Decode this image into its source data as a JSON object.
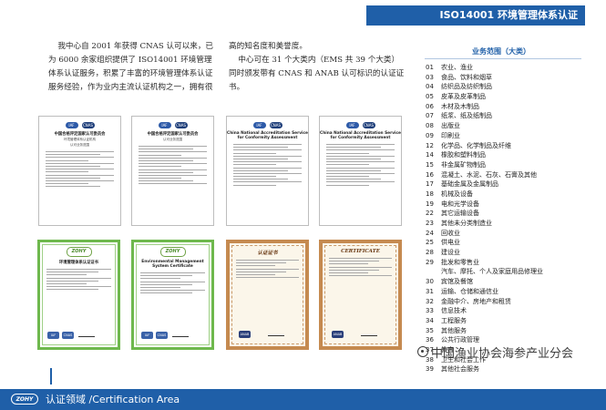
{
  "header": {
    "title": "ISO14001 环境管理体系认证"
  },
  "intro": {
    "left": "我中心自 2001 年获得 CNAS 认可以来，已为 6000 余家组织提供了 ISO14001 环境管理体系认证服务，积累了丰富的环境管理体系认证服务经验，作为业内主流认证机构之一，拥有很",
    "right_p1": "高的知名度和美誉度。",
    "right_p2": "中心可在 31 个大类内（EMS 共 39 个大类）同时颁发带有 CNAS 和 ANAB 认可标识的认证证书。"
  },
  "certs": {
    "iaf": "IAF",
    "cnas": "CNAS",
    "c1_title": "中国合格评定国家认可委员会",
    "c1_sub": "环境管理体系认证机构",
    "c1_sub2": "认可业务范围",
    "c2_title": "中国合格评定国家认可委员会",
    "c2_sub": "认可业务范围",
    "c3_title": "China National Accreditation Service for Conformity Assessment",
    "c4_title": "China National Accreditation Service for Conformity Assessment",
    "zohy": "ZOHY",
    "c5_title": "环境管理体系认证证书",
    "c6_title": "Environmental Management System Certificate",
    "c7_title": "认证证书",
    "c8_title": "CERTIFICATE",
    "anab": "ANAB"
  },
  "scope": {
    "heading": "业务范围（大类）",
    "items": [
      {
        "no": "01",
        "name": "农业、渔业"
      },
      {
        "no": "03",
        "name": "食品、饮料和烟草"
      },
      {
        "no": "04",
        "name": "纺织品及纺织制品"
      },
      {
        "no": "05",
        "name": "皮革及皮革制品"
      },
      {
        "no": "06",
        "name": "木材及木制品"
      },
      {
        "no": "07",
        "name": "纸浆、纸及纸制品"
      },
      {
        "no": "08",
        "name": "出版业"
      },
      {
        "no": "09",
        "name": "印刷业"
      },
      {
        "no": "12",
        "name": "化学品、化学制品及纤维"
      },
      {
        "no": "14",
        "name": "橡胶和塑料制品"
      },
      {
        "no": "15",
        "name": "非金属矿物制品"
      },
      {
        "no": "16",
        "name": "混凝土、水泥、石灰、石膏及其他"
      },
      {
        "no": "17",
        "name": "基础金属及金属制品"
      },
      {
        "no": "18",
        "name": "机械及设备"
      },
      {
        "no": "19",
        "name": "电和光学设备"
      },
      {
        "no": "22",
        "name": "其它运输设备"
      },
      {
        "no": "23",
        "name": "其他未分类制造业"
      },
      {
        "no": "24",
        "name": "回收业"
      },
      {
        "no": "25",
        "name": "供电业"
      },
      {
        "no": "28",
        "name": "建设业"
      },
      {
        "no": "29",
        "name": "批发和零售业"
      },
      {
        "no": "",
        "name": "汽车、摩托、个人及家庭用品修理业"
      },
      {
        "no": "30",
        "name": "宾馆及餐馆"
      },
      {
        "no": "31",
        "name": "运输、仓储和通信业"
      },
      {
        "no": "32",
        "name": "金融中介、房地产和租赁"
      },
      {
        "no": "33",
        "name": "信息技术"
      },
      {
        "no": "34",
        "name": "工程服务"
      },
      {
        "no": "35",
        "name": "其他服务"
      },
      {
        "no": "36",
        "name": "公共行政管理"
      },
      {
        "no": "37",
        "name": "教育"
      },
      {
        "no": "38",
        "name": "卫生和社会工作"
      },
      {
        "no": "39",
        "name": "其他社会服务"
      }
    ]
  },
  "watermark": {
    "text": "中国渔业协会海参产业分会"
  },
  "footer": {
    "logo": "ZOHY",
    "text": "认证领域 /Certification Area"
  },
  "colors": {
    "brand": "#1f5fa8",
    "green_frame": "#6eb84d",
    "brown_frame": "#c58a50"
  }
}
